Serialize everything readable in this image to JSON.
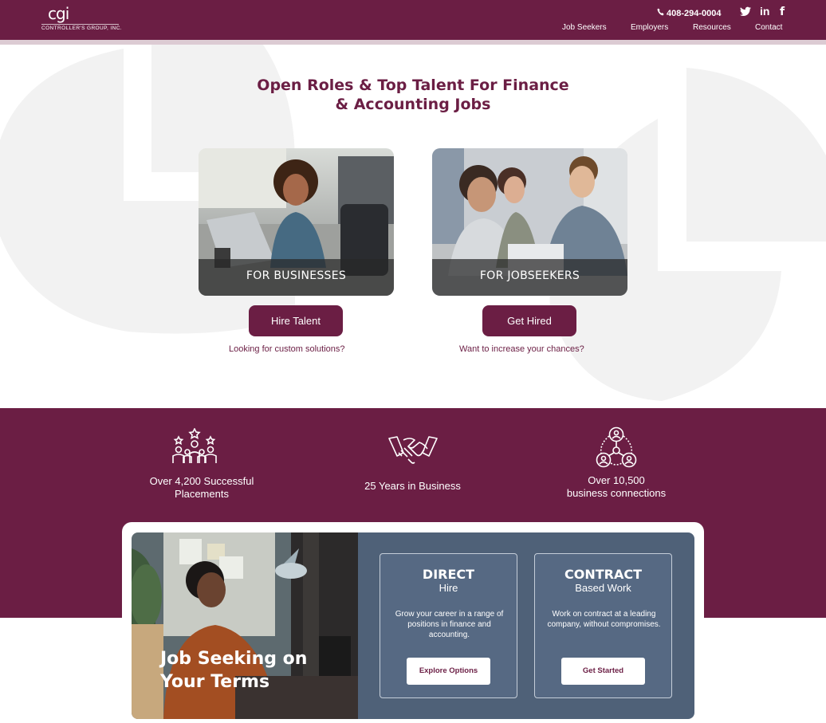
{
  "header": {
    "logo_mark": "cgi",
    "logo_sub": "CONTROLLER'S GROUP, INC.",
    "phone": "408-294-0004",
    "social": {
      "twitter": "twitter-icon",
      "linkedin": "in",
      "facebook": "f"
    },
    "nav": [
      "Job Seekers",
      "Employers",
      "Resources",
      "Contact"
    ]
  },
  "hero": {
    "headline_line1": "Open Roles & Top Talent For Finance",
    "headline_line2": "& Accounting Jobs",
    "cards": [
      {
        "label": "FOR BUSINESSES",
        "button": "Hire Talent",
        "subtext": "Looking for custom solutions?"
      },
      {
        "label": "FOR JOBSEEKERS",
        "button": "Get Hired",
        "subtext": "Want to increase your chances?"
      }
    ]
  },
  "stats": [
    {
      "icon": "team-stars-icon",
      "line1": "Over 4,200 Successful",
      "line2": "Placements"
    },
    {
      "icon": "handshake-icon",
      "line1": "25 Years in Business",
      "line2": ""
    },
    {
      "icon": "network-people-icon",
      "line1": "Over 10,500",
      "line2": "business connections"
    }
  ],
  "promo": {
    "title_line1": "Job Seeking on",
    "title_line2": "Your Terms",
    "options": [
      {
        "title": "DIRECT",
        "subtitle": "Hire",
        "desc": "Grow your career in a range of positions in finance and accounting.",
        "button": "Explore Options"
      },
      {
        "title": "CONTRACT",
        "subtitle": "Based Work",
        "desc": "Work on contract at a leading company, without compromises.",
        "button": "Get Started"
      }
    ]
  },
  "colors": {
    "brand": "#6b1e44",
    "panel": "#4f6178",
    "bg_shape": "#f2f2f2"
  }
}
